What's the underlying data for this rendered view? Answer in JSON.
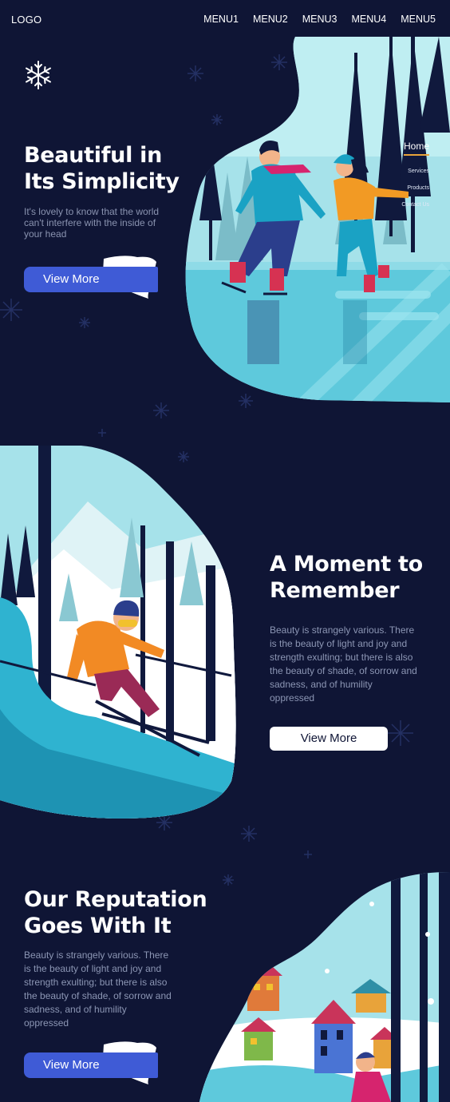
{
  "header": {
    "logo": "LOGO",
    "menu": [
      "MENU1",
      "MENU2",
      "MENU3",
      "MENU4",
      "MENU5"
    ]
  },
  "sidenav": {
    "home": "Home",
    "items": [
      "Services",
      "Products",
      "Contact Us"
    ]
  },
  "hero": {
    "title_line1": "Beautiful in",
    "title_line2": "Its Simplicity",
    "text_line1": "It's lovely to know that the world",
    "text_line2": "can't interfere with the inside of",
    "text_line3": "your head",
    "button": "View More"
  },
  "moment": {
    "title_line1": "A Moment to",
    "title_line2": "Remember",
    "lines": [
      "Beauty is strangely various. There",
      "is the beauty of light and joy and",
      "strength exulting; but there is also",
      "the beauty of shade, of sorrow and",
      "sadness, and of humility",
      "oppressed"
    ],
    "button": "View More"
  },
  "reputation": {
    "title_line1": "Our Reputation",
    "title_line2": "Goes With It",
    "lines": [
      "Beauty is strangely various. There",
      "is the beauty of light and joy and",
      "strength exulting; but there is also",
      "the beauty of shade, of sorrow and",
      "sadness, and of humility",
      "oppressed"
    ],
    "button": "View More"
  },
  "colors": {
    "background": "#0f1535",
    "accent_blue": "#3f5bd6",
    "accent_orange": "#e8a33a",
    "ice": "#5ec9dc",
    "sky": "#a6e2ea"
  },
  "icons": [
    "snowflake-icon"
  ]
}
